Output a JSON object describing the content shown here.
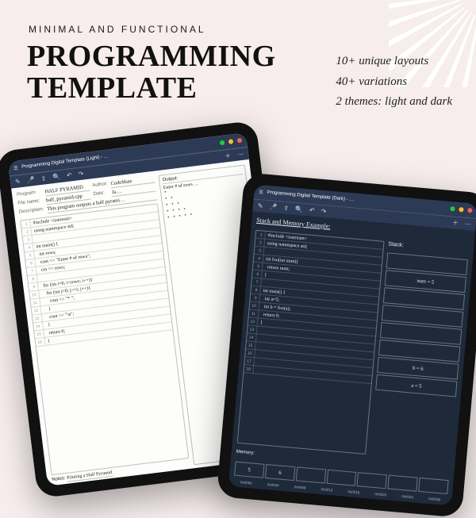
{
  "marketing": {
    "tagline": "MINIMAL AND FUNCTIONAL",
    "title_l1": "PROGRAMMING",
    "title_l2": "TEMPLATE",
    "bullet1": "10+ unique layouts",
    "bullet2": "40+ variations",
    "bullet3": "2 themes: light and dark"
  },
  "light": {
    "appbar_title": "Programming Digital Template (Light) - …",
    "program_lbl": "Program:",
    "program_val": "HALF PYRAMID",
    "author_lbl": "Author:",
    "author_val": "CodeMate",
    "file_lbl": "File name:",
    "file_val": "half_pyramid.cpp",
    "date_lbl": "Date:",
    "date_val": "Ja…",
    "desc_lbl": "Description:",
    "desc_val": "This program outputs a half pyrami…",
    "output_title": "Output:",
    "output_l1": "Enter # of rows …",
    "code": [
      "#include <iostream>",
      "using namespace std;",
      "",
      "int main() {",
      "  int rows;",
      "  cout << \"Enter # of rows\";",
      "  cin >> rows;",
      "",
      "  for (int i=0; i<rows; i++){",
      "    for (int j=0; j<=i; j++){",
      "      cout << \"* \";",
      "    }",
      "    cout << \"\\n\";",
      "  }",
      "  return 0;",
      "}"
    ],
    "notes_lbl": "Notes:",
    "notes_val": "Printing a Half Pyramid"
  },
  "dark": {
    "appbar_title": "Programming Digital Template (Dark) - …",
    "section": "Stack and Memory Example:",
    "stack_title": "Stack:",
    "code": [
      "#include <iostream>",
      "using namespace std;",
      "",
      "int foo(int num){",
      "  return num;",
      "}",
      "",
      "int main() {",
      "  int a=5;",
      "  int b = foo(a);",
      "  return 0;",
      "}",
      "",
      "",
      "",
      "",
      "",
      ""
    ],
    "stack": [
      "",
      "num = 5",
      "",
      "",
      "",
      "",
      "b = 6",
      "a = 5"
    ],
    "memory_lbl": "Memory:",
    "memory": [
      "5",
      "6",
      "",
      "",
      "",
      "",
      ""
    ],
    "addr": [
      "0x0000",
      "0x0004",
      "0x0008",
      "0x0012",
      "0x0016",
      "0x0020",
      "0x0024",
      "0x0028"
    ]
  }
}
